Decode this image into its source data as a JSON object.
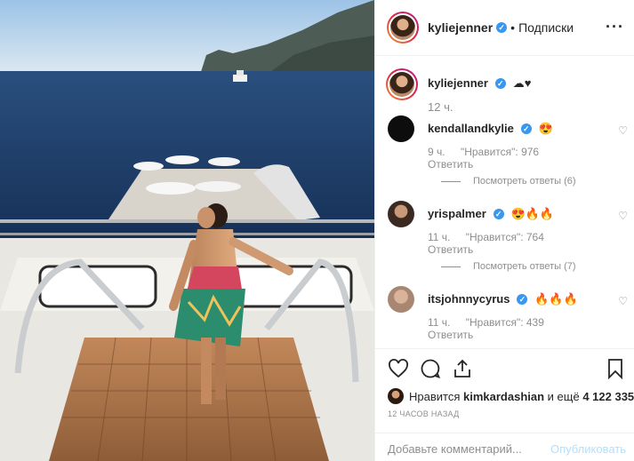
{
  "post": {
    "author": "kyliejenner",
    "follow_label": "Подписки",
    "separator": "•",
    "more_icon": "more-horizontal-icon",
    "photo_alt": "photo"
  },
  "caption": {
    "author": "kyliejenner",
    "text": "☁♥",
    "time": "12 ч."
  },
  "comments": [
    {
      "author": "kendallandkylie",
      "text": "😍",
      "time": "9 ч.",
      "likes": "\"Нравится\": 976",
      "reply": "Ответить",
      "thread": "Посмотреть ответы (6)"
    },
    {
      "author": "yrispalmer",
      "text": "😍🔥🔥",
      "time": "11 ч.",
      "likes": "\"Нравится\": 764",
      "reply": "Ответить",
      "thread": "Посмотреть ответы (7)"
    },
    {
      "author": "itsjohnnycyrus",
      "text": "🔥🔥🔥",
      "time": "11 ч.",
      "likes": "\"Нравится\": 439",
      "reply": "Ответить",
      "thread": ""
    }
  ],
  "likes_line": {
    "prefix": "Нравится",
    "liker": "kimkardashian",
    "middle": "и ещё",
    "count": "4 122 335"
  },
  "timestamp": "12 ЧАСОВ НАЗАД",
  "comment_input": {
    "placeholder": "Добавьте комментарий...",
    "post_label": "Опубликовать"
  },
  "colors": {
    "link_blue": "#3897f0",
    "post_disabled": "#b2dffc",
    "muted": "#8e8e8e",
    "verified": "#3897f0"
  }
}
